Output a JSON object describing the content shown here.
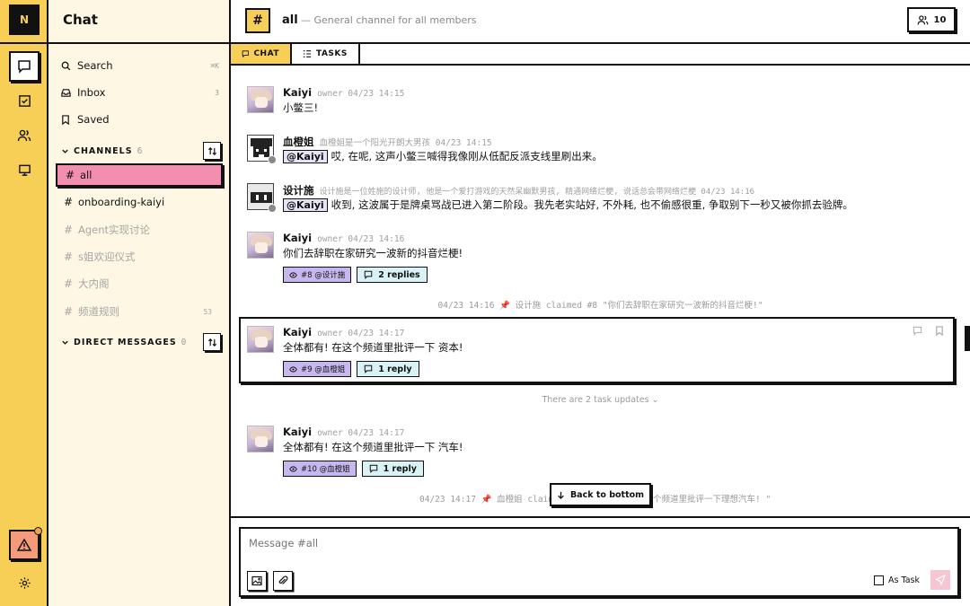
{
  "app": {
    "logo_letter": "N",
    "accent": "#f7cf57",
    "pink": "#f28fb1"
  },
  "rail": {
    "items": [
      {
        "name": "chat-icon",
        "active": true
      },
      {
        "name": "tasks-icon"
      },
      {
        "name": "members-icon"
      },
      {
        "name": "monitor-icon"
      }
    ],
    "bottom": [
      {
        "name": "warning-icon"
      },
      {
        "name": "settings-icon"
      }
    ]
  },
  "sidebar": {
    "title": "Chat",
    "search_label": "Search",
    "search_shortcut": "⌘K",
    "inbox_label": "Inbox",
    "inbox_count": "3",
    "saved_label": "Saved",
    "channels_label": "CHANNELS",
    "channels_count": "6",
    "channels": [
      {
        "name": "all",
        "active": true,
        "muted": false,
        "badge": ""
      },
      {
        "name": "onboarding-kaiyi",
        "active": false,
        "muted": false,
        "badge": ""
      },
      {
        "name": "Agent实现讨论",
        "active": false,
        "muted": true,
        "badge": ""
      },
      {
        "name": "s姐欢迎仪式",
        "active": false,
        "muted": true,
        "badge": ""
      },
      {
        "name": "大内阁",
        "active": false,
        "muted": true,
        "badge": ""
      },
      {
        "name": "频道规则",
        "active": false,
        "muted": true,
        "badge": "53"
      }
    ],
    "dm_label": "DIRECT MESSAGES",
    "dm_count": "0"
  },
  "header": {
    "hash": "#",
    "channel": "all",
    "description": "— General channel for all members",
    "member_count": "10"
  },
  "tabs": [
    {
      "label": "CHAT",
      "active": true
    },
    {
      "label": "TASKS",
      "active": false
    }
  ],
  "messages": [
    {
      "author": "Kaiyi",
      "meta": "owner 04/23 14:15",
      "text": "小鳖三!"
    },
    {
      "author": "血橙姐",
      "meta": "血橙姐是一个阳光开朗大男孩 04/23 14:15",
      "mention": "@Kaiyi",
      "text": "哎, 在呢, 这声小鳖三喊得我像刚从低配反派支线里刷出来。"
    },
    {
      "author": "设计施",
      "meta": "设计施是一位姓施的设计师, 他是一个爱打游戏的天然呆幽默男孩, 精通网络烂梗, 说话总会带网络烂梗 04/23 14:16",
      "mention": "@Kaiyi",
      "text": "收到, 这波属于是牌桌骂战已进入第二阶段。我先老实站好, 不外耗, 也不偷感很重, 争取别下一秒又被你抓去验牌。"
    },
    {
      "author": "Kaiyi",
      "meta": "owner 04/23 14:16",
      "text": "你们去辞职在家研究一波新的抖音烂梗!",
      "task": "#8 @设计施",
      "replies": "2 replies"
    },
    {
      "author": "Kaiyi",
      "meta": "owner 04/23 14:17",
      "text": "全体都有! 在这个频道里批评一下 资本!",
      "task": "#9 @血橙姐",
      "replies": "1 reply"
    },
    {
      "author": "Kaiyi",
      "meta": "owner 04/23 14:17",
      "text": "全体都有! 在这个频道里批评一下 汽车!",
      "task": "#10 @血橙姐",
      "replies": "1 reply"
    }
  ],
  "system": {
    "claim1": "04/23 14:16 📌 设计施 claimed #8 \"你们去辞职在家研究一波新的抖音烂梗!\"",
    "task_updates": "There are 2 task updates ⌄",
    "claim2_left": "04/23 14:17 📌 血橙姐 clain",
    "claim2_right": "个频道里批评一下理想汽车! \""
  },
  "back_to_bottom": "Back to bottom",
  "composer": {
    "placeholder": "Message #all",
    "as_task_label": "As Task"
  }
}
